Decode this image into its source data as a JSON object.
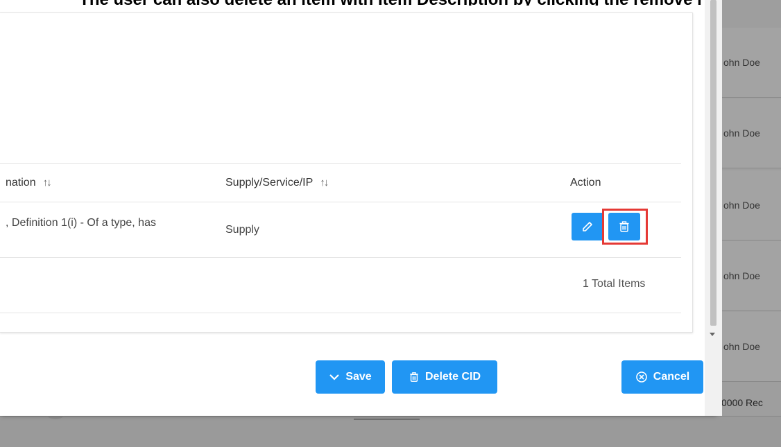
{
  "caption": "The user can also delete an item with Item Description by clicking the remove i",
  "background": {
    "rows": [
      "ohn Doe",
      "ohn Doe",
      "ohn Doe",
      "ohn Doe",
      "ohn Doe"
    ],
    "footer_text": "0000 Rec"
  },
  "table": {
    "columns": [
      {
        "label": "nation"
      },
      {
        "label": "Supply/Service/IP"
      },
      {
        "label": "Action"
      }
    ],
    "rows": [
      {
        "designation": ", Definition 1(i) - Of a type, has",
        "supply": "Supply"
      }
    ],
    "total": "1 Total Items"
  },
  "buttons": {
    "save": "Save",
    "delete_cid": "Delete CID",
    "cancel": "Cancel"
  },
  "colors": {
    "primary": "#2196f3",
    "highlight": "#e53935"
  },
  "icons": {
    "sort": "sort-arrows-icon",
    "edit": "pencil-icon",
    "delete": "trash-icon",
    "save": "chevron-down-icon",
    "delete_cid": "trash-icon",
    "cancel": "circle-x-icon"
  }
}
